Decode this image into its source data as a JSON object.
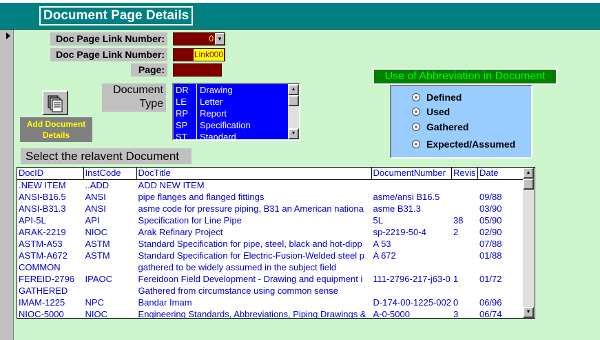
{
  "form": {
    "title": "Document Page Details",
    "fields": {
      "doc_page_link_number_1": {
        "label": "Doc Page Link Number:",
        "value": "0"
      },
      "doc_page_link_number_2": {
        "label": "Doc Page Link Number:",
        "value": "Link000"
      },
      "page": {
        "label": "Page:",
        "value": ""
      }
    },
    "document_type": {
      "label_line1": "Document",
      "label_line2": "Type",
      "items": [
        {
          "code": "DR",
          "name": "Drawing"
        },
        {
          "code": "LE",
          "name": "Letter"
        },
        {
          "code": "RP",
          "name": "Report"
        },
        {
          "code": "SP",
          "name": "Specification"
        },
        {
          "code": "ST",
          "name": "Standard"
        }
      ]
    },
    "add_document_button": {
      "line1": "Add Document",
      "line2": "Details"
    },
    "select_label": "Select the relavent Document",
    "abbreviation": {
      "title": "Use of Abbreviation in Document",
      "options": [
        "Defined",
        "Used",
        "Gathered",
        "Expected/Assumed"
      ]
    }
  },
  "grid": {
    "columns": [
      "DocID",
      "InstCode",
      "DocTitle",
      "DocumentNumber",
      "Revis",
      "Date"
    ],
    "rows": [
      [
        ".NEW ITEM",
        "..ADD",
        "ADD NEW ITEM",
        "",
        "",
        ""
      ],
      [
        "ANSI-B16.5",
        "ANSI",
        "pipe flanges and flanged fittings",
        "asme/ansi B16.5",
        "",
        "09/88"
      ],
      [
        "ANSI-B31.3",
        "ANSI",
        "asme code for pressure piping, B31 an American nationa",
        "asme B31.3",
        "",
        "03/90"
      ],
      [
        "API-5L",
        "API",
        "Specification for Line Pipe",
        "5L",
        "38",
        "05/90"
      ],
      [
        "ARAK-2219",
        "NIOC",
        "Arak Refinary Project",
        "sp-2219-50-4",
        "2",
        "02/90"
      ],
      [
        "ASTM-A53",
        "ASTM",
        "Standard Specification for pipe, steel, black and hot-dipp",
        "A 53",
        "",
        "07/88"
      ],
      [
        "ASTM-A672",
        "ASTM",
        "Standard Specification for Electric-Fusion-Welded steel p",
        "A 672",
        "",
        "01/88"
      ],
      [
        "COMMON",
        "",
        "gathered to be widely assumed in the subject field",
        "",
        "",
        ""
      ],
      [
        "FEREID-2796",
        "IPAOC",
        "Fereidoon Field Development - Drawing and equipment i",
        "111-2796-217-j63-0",
        "1",
        "01/72"
      ],
      [
        "GATHERED",
        "",
        "Gathered from circumstance using common sense",
        "",
        "",
        ""
      ],
      [
        "IMAM-1225",
        "NPC",
        "Bandar Imam",
        "D-174-00-1225-002",
        "0",
        "06/96"
      ],
      [
        "NIOC-5000",
        "NIOC",
        "Engineering Standards, Abbreviations, Piping Drawings &",
        "A-0-5000",
        "3",
        "06/74"
      ]
    ]
  },
  "icons": {
    "record_selector": "record-pointer-arrow",
    "add_document": "documents-stack-icon",
    "scroll_up": "arrow-up-icon",
    "scroll_down": "arrow-down-icon",
    "combo": "dropdown-arrow-icon"
  },
  "colors": {
    "header": "#008080",
    "form_bg": "#ccf5cc",
    "field_bg": "#800000",
    "listbox_bg": "#0000ff",
    "abbr_title_bg": "#008000",
    "abbr_panel_bg": "#99ccff",
    "grid_text": "#0000cc"
  }
}
